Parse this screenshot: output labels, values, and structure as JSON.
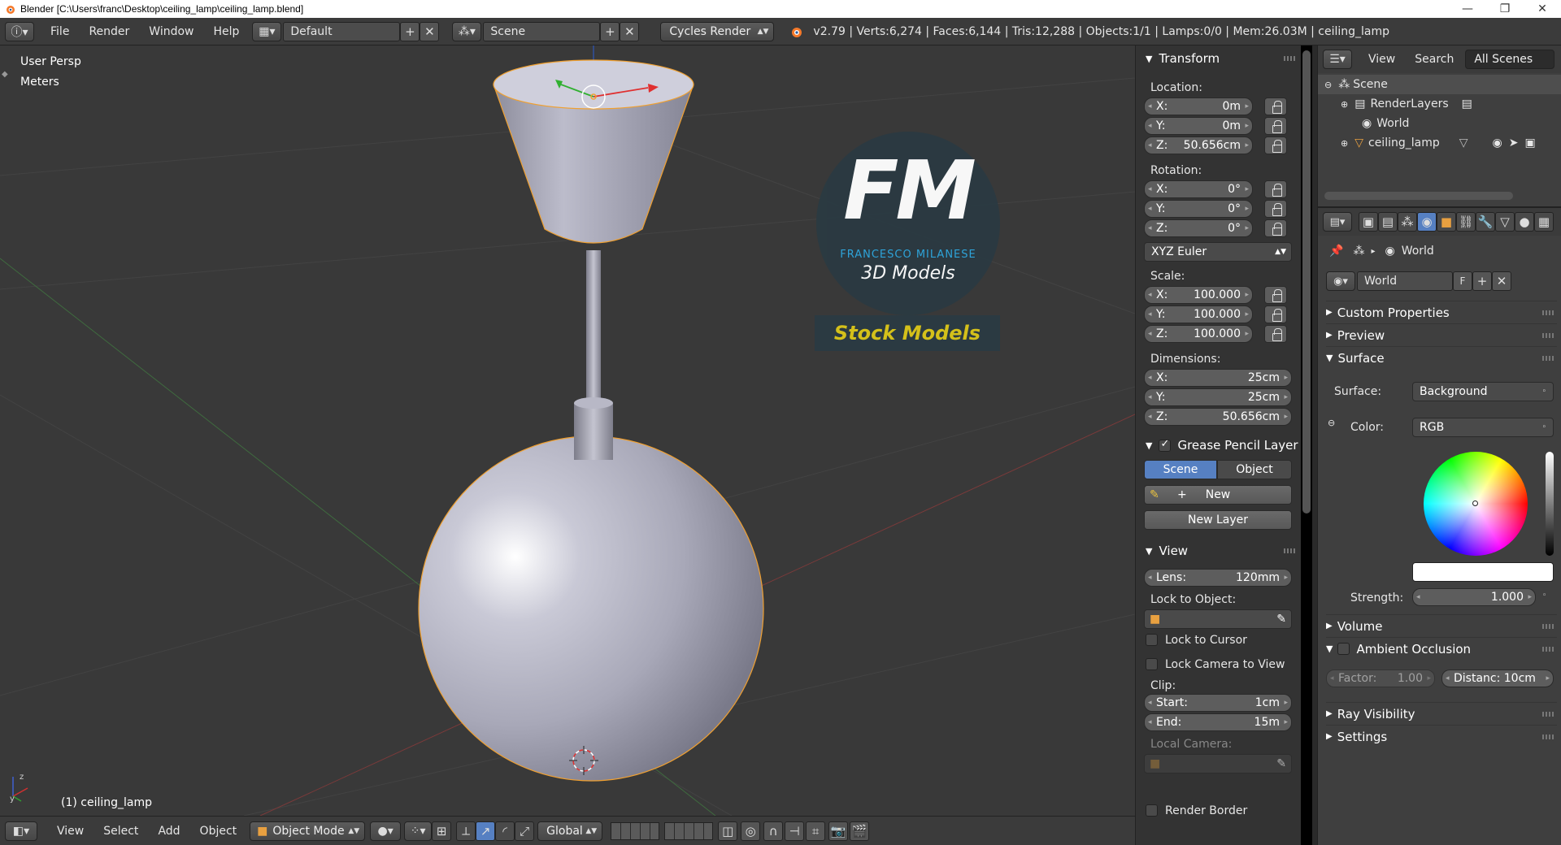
{
  "window": {
    "title": "Blender [C:\\Users\\franc\\Desktop\\ceiling_lamp\\ceiling_lamp.blend]",
    "minimize": "—",
    "maximize": "❐",
    "close": "✕"
  },
  "infobar": {
    "menus": [
      "File",
      "Render",
      "Window",
      "Help"
    ],
    "layout": "Default",
    "scene": "Scene",
    "engine": "Cycles Render",
    "stats": "v2.79 | Verts:6,274 | Faces:6,144 | Tris:12,288 | Objects:1/1 | Lamps:0/0 | Mem:26.03M | ceiling_lamp"
  },
  "viewport": {
    "view_name": "User Persp",
    "units": "Meters",
    "active_object": "(1) ceiling_lamp",
    "logo": {
      "initials": "FM",
      "author": "FRANCESCO MILANESE",
      "subtitle": "3D Models",
      "banner": "Stock Models"
    }
  },
  "footer": {
    "menus": [
      "View",
      "Select",
      "Add",
      "Object"
    ],
    "mode": "Object Mode",
    "orientation": "Global"
  },
  "npanel": {
    "transform_title": "Transform",
    "location_label": "Location:",
    "location": [
      {
        "axis": "X:",
        "value": "0m"
      },
      {
        "axis": "Y:",
        "value": "0m"
      },
      {
        "axis": "Z:",
        "value": "50.656cm"
      }
    ],
    "rotation_label": "Rotation:",
    "rotation": [
      {
        "axis": "X:",
        "value": "0°"
      },
      {
        "axis": "Y:",
        "value": "0°"
      },
      {
        "axis": "Z:",
        "value": "0°"
      }
    ],
    "rotation_mode": "XYZ Euler",
    "scale_label": "Scale:",
    "scale": [
      {
        "axis": "X:",
        "value": "100.000"
      },
      {
        "axis": "Y:",
        "value": "100.000"
      },
      {
        "axis": "Z:",
        "value": "100.000"
      }
    ],
    "dimensions_label": "Dimensions:",
    "dimensions": [
      {
        "axis": "X:",
        "value": "25cm"
      },
      {
        "axis": "Y:",
        "value": "25cm"
      },
      {
        "axis": "Z:",
        "value": "50.656cm"
      }
    ],
    "grease_title": "Grease Pencil Layer",
    "grease_scene_tab": "Scene",
    "grease_object_tab": "Object",
    "grease_new": "New",
    "grease_new_layer": "New Layer",
    "view_title": "View",
    "lens": {
      "axis": "Lens:",
      "value": "120mm"
    },
    "lock_to_object": "Lock to Object:",
    "lock_to_cursor": "Lock to Cursor",
    "lock_camera": "Lock Camera to View",
    "clip_label": "Clip:",
    "clip_start": {
      "axis": "Start:",
      "value": "1cm"
    },
    "clip_end": {
      "axis": "End:",
      "value": "15m"
    },
    "local_camera": "Local Camera:",
    "render_border": "Render Border"
  },
  "outliner": {
    "view": "View",
    "search": "Search",
    "filter": "All Scenes",
    "items": [
      "Scene",
      "RenderLayers",
      "World",
      "ceiling_lamp"
    ]
  },
  "properties": {
    "breadcrumb": "World",
    "world_name": "World",
    "fake_user": "F",
    "sections": {
      "custom_props": "Custom Properties",
      "preview": "Preview",
      "surface": "Surface",
      "volume": "Volume",
      "ao": "Ambient Occlusion",
      "ray_vis": "Ray Visibility",
      "settings": "Settings"
    },
    "surface_label": "Surface:",
    "surface_value": "Background",
    "color_label": "Color:",
    "color_mode": "RGB",
    "strength_label": "Strength:",
    "strength_value": "1.000",
    "ao_factor": "Factor:",
    "ao_factor_value": "1.00",
    "ao_distance": "Distanc: 10cm"
  },
  "colors": {
    "accent_blue": "#5680c2",
    "selection_orange": "#f0a030",
    "logo_blue": "#2ea8e0",
    "banner_yellow": "#d4c01a"
  }
}
